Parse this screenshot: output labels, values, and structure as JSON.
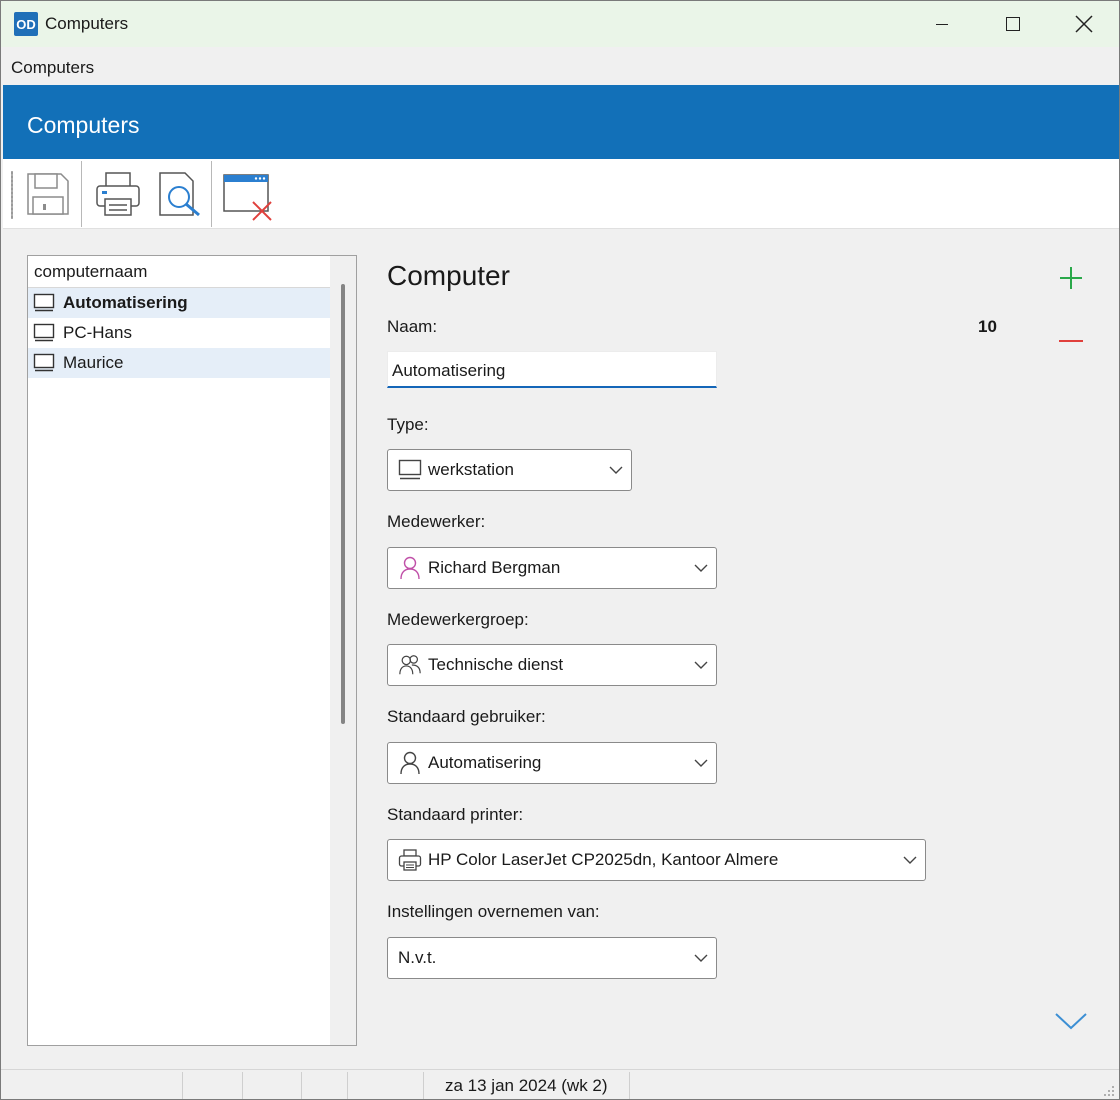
{
  "window": {
    "logo_text": "OD",
    "title": "Computers"
  },
  "menu": {
    "items": [
      "Computers"
    ]
  },
  "header": {
    "title": "Computers"
  },
  "toolbar": {
    "buttons": [
      "save-icon",
      "print-icon",
      "print-preview-icon",
      "close-window-icon"
    ]
  },
  "list": {
    "column_header": "computernaam",
    "items": [
      {
        "label": "Automatisering",
        "icon": "monitor-icon",
        "selected": true
      },
      {
        "label": "PC-Hans",
        "icon": "monitor-icon",
        "selected": false
      },
      {
        "label": "Maurice",
        "icon": "monitor-icon",
        "selected": true
      }
    ]
  },
  "form": {
    "title": "Computer",
    "naam_label": "Naam:",
    "id_value": "10",
    "naam_value": "Automatisering",
    "type_label": "Type:",
    "type_value": "werkstation",
    "medewerker_label": "Medewerker:",
    "medewerker_value": "Richard Bergman",
    "medewerkergroep_label": "Medewerkergroep:",
    "medewerkergroep_value": "Technische dienst",
    "gebruiker_label": "Standaard gebruiker:",
    "gebruiker_value": "Automatisering",
    "printer_label": "Standaard printer:",
    "printer_value": "HP Color LaserJet CP2025dn, Kantoor Almere",
    "instellingen_label": "Instellingen overnemen van:",
    "instellingen_value": "N.v.t."
  },
  "colors": {
    "header_band": "#1270b8",
    "add": "#2aa84a",
    "remove": "#e0403c",
    "expand": "#3c8fd4",
    "title_bar": "#eaf5e8"
  },
  "statusbar": {
    "date": "za 13 jan 2024 (wk 2)"
  }
}
